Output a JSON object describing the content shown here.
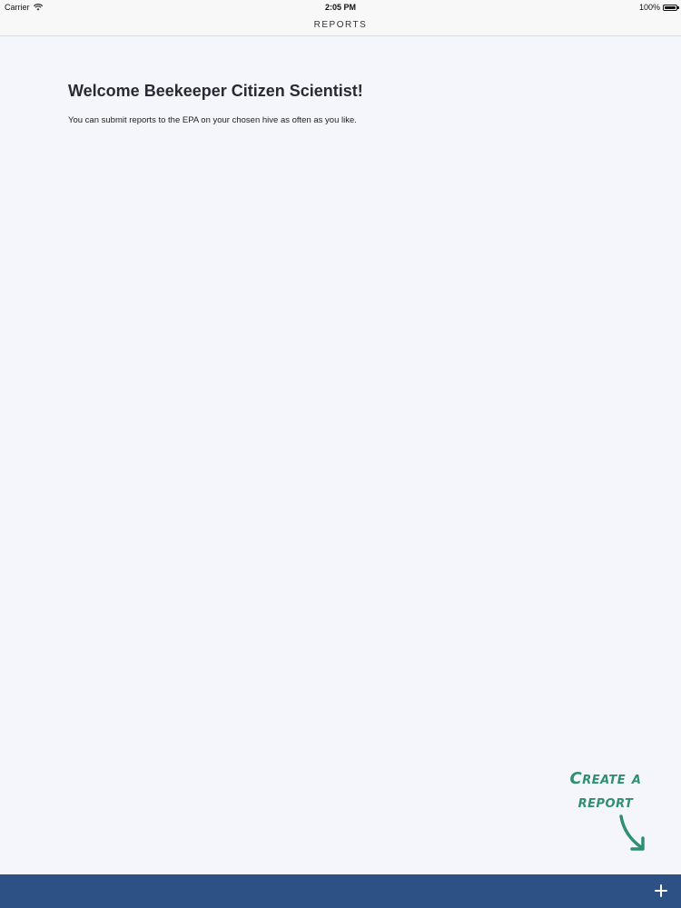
{
  "status_bar": {
    "carrier": "Carrier",
    "time": "2:05 PM",
    "battery": "100%",
    "battery_level": 1.0
  },
  "nav": {
    "title": "REPORTS"
  },
  "content": {
    "heading": "Welcome Beekeeper Citizen Scientist!",
    "body": "You can submit reports to the EPA on your chosen hive as often as you like."
  },
  "hint": {
    "line1": "Create a",
    "line2": "report"
  },
  "toolbar": {
    "add_icon": "plus-icon",
    "background_color": "#2d5085"
  },
  "colors": {
    "accent": "#2f8f6f",
    "toolbar": "#2d5085",
    "background": "#f5f6fb"
  }
}
